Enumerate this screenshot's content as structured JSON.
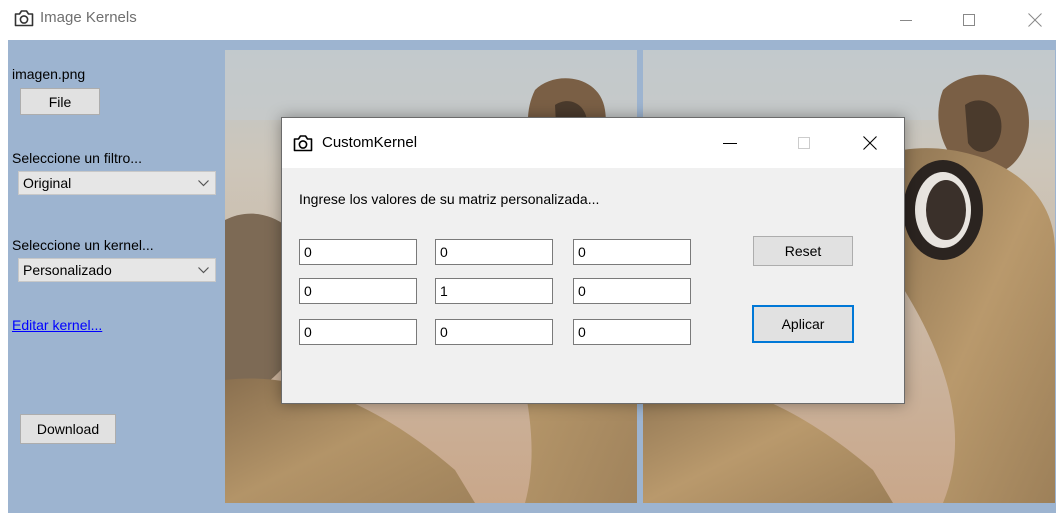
{
  "window": {
    "title": "Image Kernels",
    "controls": [
      "minimize-icon",
      "maximize-icon",
      "close-icon"
    ]
  },
  "left_panel": {
    "file_name": "imagen.png",
    "file_button": "File",
    "filter_label": "Seleccione un filtro...",
    "filter_selected": "Original",
    "kernel_label": "Seleccione un kernel...",
    "kernel_selected": "Personalizado",
    "edit_link": "Editar kernel...",
    "download_button": "Download"
  },
  "dialog": {
    "title": "CustomKernel",
    "prompt": "Ingrese los valores de su matriz personalizada...",
    "matrix": [
      [
        "0",
        "0",
        "0"
      ],
      [
        "0",
        "1",
        "0"
      ],
      [
        "0",
        "0",
        "0"
      ]
    ],
    "reset_button": "Reset",
    "apply_button": "Aplicar"
  },
  "colors": {
    "client_background": "#9db4d0",
    "dialog_background": "#f0f0f0",
    "link": "#0000ff",
    "default_button_border": "#0078d7"
  }
}
